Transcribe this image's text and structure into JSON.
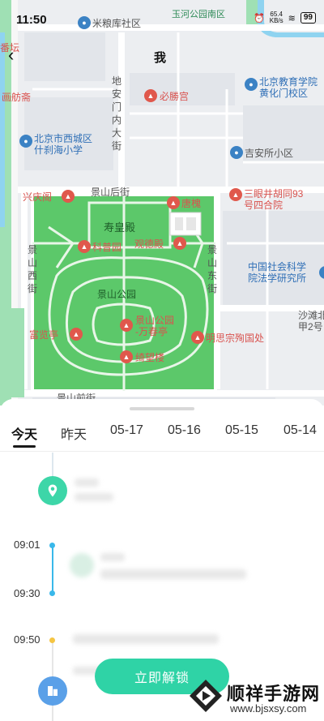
{
  "status": {
    "time": "11:50",
    "battery": "99",
    "net_top": "65.4",
    "net_bottom": "KB/s"
  },
  "map": {
    "title": "我",
    "back_glyph": "‹",
    "pois": {
      "mifenku": "米粮库社区",
      "yuhe": "玉河公园南区",
      "bisheng": "必勝宫",
      "huadanzhai": "画舫斋",
      "jiaoyu1": "北京教育学院",
      "jiaoyu2": "黄化门校区",
      "xicheng1": "北京市西城区",
      "xicheng2": "什刹海小学",
      "jianvsuo": "吉安所小区",
      "xingqing": "兴庆阁",
      "jinshanhou": "景山后街",
      "tanghuai": "唐槐",
      "sanyan1": "三眼井胡同93",
      "sanyan2": "号四合院",
      "shouhuang": "寿皇殿",
      "kepu": "科普园",
      "guande": "观德殿",
      "jinshanpark": "景山公园",
      "shekeyuan1": "中国社会科学",
      "shekeyuan2": "院法学研究所",
      "fulan": "富览亭",
      "wanchun1": "景山公园",
      "wanchun2": "-万春亭",
      "mingsi": "明思宗殉国处",
      "jiwang": "绮望楼",
      "shatan1": "沙滩北",
      "shatan2": "甲2号",
      "jinshanqian": "景山前街",
      "fandeng": "番坛"
    },
    "streets": {
      "dianmen": "地安门内大街",
      "jinshanxi": "景山西街",
      "jinshandong": "景山东街"
    }
  },
  "tabs": [
    "今天",
    "昨天",
    "05-17",
    "05-16",
    "05-15",
    "05-14"
  ],
  "timeline": {
    "times": [
      "09:01",
      "09:30",
      "09:50"
    ]
  },
  "unlock_label": "立即解锁",
  "watermark": {
    "title": "顺祥手游网",
    "url": "www.bjsxsy.com"
  },
  "colors": {
    "accent": "#2fd3a6",
    "park": "#5cc86a",
    "line": "#39b8ea",
    "dot_yellow": "#f5c542"
  }
}
